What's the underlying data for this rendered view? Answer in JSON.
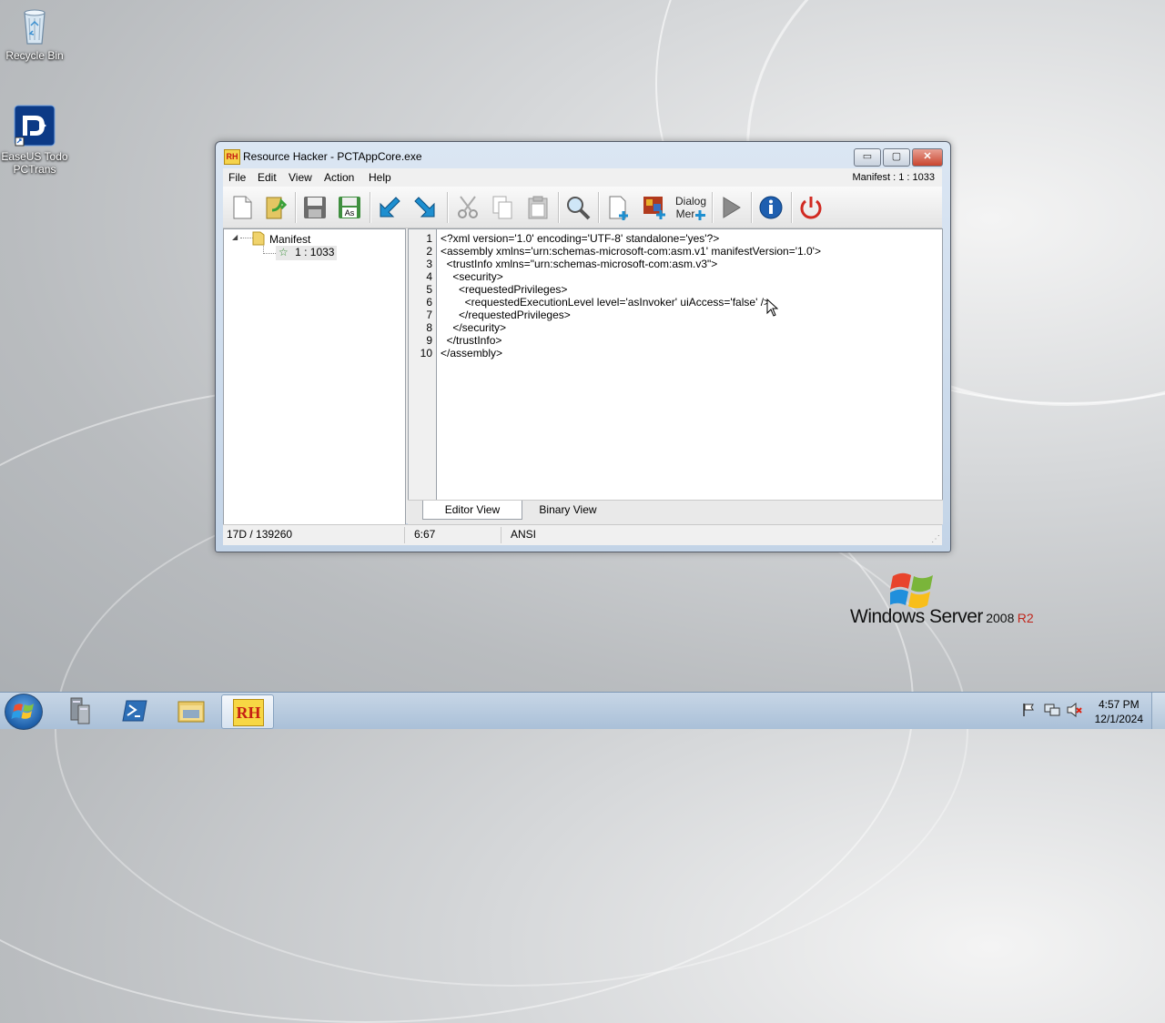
{
  "desktop": {
    "icons": [
      {
        "label": "Recycle Bin",
        "icon": "recycle-bin-icon"
      },
      {
        "label": "EaseUS Todo PCTrans",
        "icon": "easeus-todo-pctrans-icon"
      }
    ],
    "brand": {
      "product": "Windows Server",
      "version": "2008",
      "edition": "R2"
    }
  },
  "window": {
    "title": "Resource Hacker - PCTAppCore.exe",
    "logo_text": "RH",
    "controls": {
      "minimize": "▭",
      "maximize": "▢",
      "close": "✕"
    },
    "menu": [
      "File",
      "Edit",
      "View",
      "Action",
      "Help"
    ],
    "resource_indicator": "Manifest : 1 : 1033",
    "toolbar": [
      {
        "name": "new-file-icon"
      },
      {
        "name": "open-file-icon"
      },
      {
        "name": "save-icon"
      },
      {
        "name": "save-as-icon",
        "text": "As"
      },
      {
        "name": "back-arrow-icon"
      },
      {
        "name": "forward-arrow-icon"
      },
      {
        "name": "cut-icon"
      },
      {
        "name": "copy-icon"
      },
      {
        "name": "paste-icon"
      },
      {
        "name": "find-icon"
      },
      {
        "name": "add-resource-icon"
      },
      {
        "name": "add-image-icon"
      },
      {
        "name": "dialog-merger-icon",
        "text": "Dialog Mer"
      },
      {
        "name": "compile-run-icon"
      },
      {
        "name": "info-icon"
      },
      {
        "name": "exit-icon"
      }
    ],
    "tree": {
      "root": "Manifest",
      "child": "1 : 1033"
    },
    "editor": {
      "line_numbers": [
        "1",
        "2",
        "3",
        "4",
        "5",
        "6",
        "7",
        "8",
        "9",
        "10"
      ],
      "lines": [
        "<?xml version='1.0' encoding='UTF-8' standalone='yes'?>",
        "<assembly xmlns='urn:schemas-microsoft-com:asm.v1' manifestVersion='1.0'>",
        "  <trustInfo xmlns=\"urn:schemas-microsoft-com:asm.v3\">",
        "    <security>",
        "      <requestedPrivileges>",
        "        <requestedExecutionLevel level='asInvoker' uiAccess='false' />",
        "      </requestedPrivileges>",
        "    </security>",
        "  </trustInfo>",
        "</assembly>"
      ]
    },
    "tabs": [
      "Editor View",
      "Binary View"
    ],
    "status": {
      "offset": "17D / 139260",
      "position": "6:67",
      "encoding": "ANSI"
    }
  },
  "taskbar": {
    "items": [
      "server-manager-icon",
      "powershell-icon",
      "file-explorer-icon",
      "resource-hacker-taskbar-icon"
    ],
    "active_label": "RH",
    "clock": {
      "time": "4:57 PM",
      "date": "12/1/2024"
    }
  }
}
